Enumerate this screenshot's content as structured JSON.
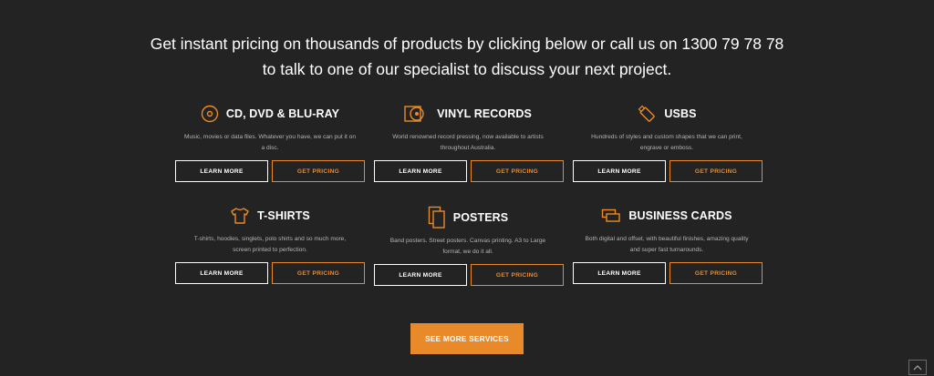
{
  "headline": {
    "line1": "Get instant pricing on thousands of products by clicking below or call us on 1300 79 78 78",
    "line2": "to talk to one of our specialist to discuss your next project."
  },
  "services": [
    {
      "title": "CD, DVD & BLU-RAY",
      "icon": "disc-icon",
      "desc1": "Music, movies or data files. Whatever you have, we can put it on",
      "desc2": "a disc.",
      "learn": "LEARN MORE",
      "price": "GET PRICING"
    },
    {
      "title": "VINYL RECORDS",
      "icon": "vinyl-record-icon",
      "desc1": "World renowned record pressing, now available to artists",
      "desc2": "throughout Australia.",
      "learn": "LEARN MORE",
      "price": "GET PRICING"
    },
    {
      "title": "USBS",
      "icon": "usb-icon",
      "desc1": "Hundreds of styles and custom shapes that we can print,",
      "desc2": "engrave or emboss.",
      "learn": "LEARN MORE",
      "price": "GET PRICING"
    },
    {
      "title": "T-SHIRTS",
      "icon": "tshirt-icon",
      "desc1": "T-shirts, hoodies, singlets, polo shirts and so much more,",
      "desc2": "screen printed to perfection.",
      "learn": "LEARN MORE",
      "price": "GET PRICING"
    },
    {
      "title": "POSTERS",
      "icon": "poster-icon",
      "desc1": "Band posters. Street posters. Canvas printing. A3 to Large",
      "desc2": "format, we do it all.",
      "learn": "LEARN MORE",
      "price": "GET PRICING"
    },
    {
      "title": "BUSINESS CARDS",
      "icon": "business-cards-icon",
      "desc1": "Both digital and offset, with beautiful finishes, amazing quality",
      "desc2": "and super fast turnarounds.",
      "learn": "LEARN MORE",
      "price": "GET PRICING"
    }
  ],
  "see_more": "SEE MORE SERVICES",
  "colors": {
    "background": "#232323",
    "accent": "#e98a2a",
    "text": "#ffffff",
    "muted": "#b4b4b4"
  }
}
